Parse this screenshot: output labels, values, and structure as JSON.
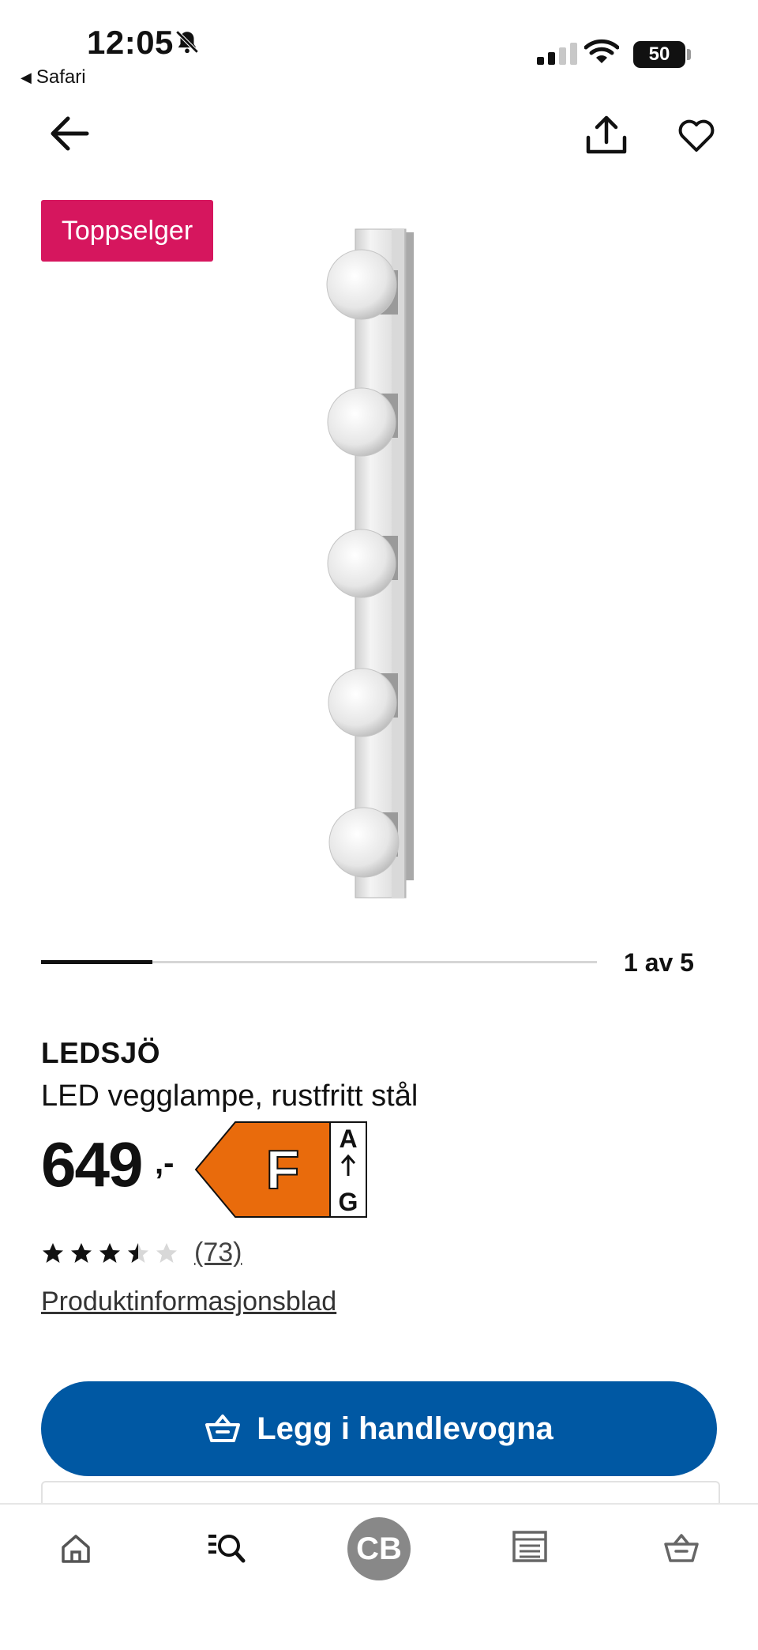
{
  "status": {
    "time": "12:05",
    "back_app": "Safari",
    "battery": "50"
  },
  "badge": "Toppselger",
  "carousel": {
    "pager": "1 av 5",
    "progress": 0.2
  },
  "product": {
    "brand": "LEDSJÖ",
    "description": "LED vegglampe, rustfritt stål",
    "price": "649",
    "price_suffix": ",-",
    "energy_class": "F",
    "energy_scale_top": "A",
    "energy_scale_bottom": "G",
    "rating": 3.5,
    "rating_max": 5,
    "reviews": "(73)",
    "info_link": "Produktinformasjonsblad"
  },
  "cta": {
    "label": "Legg i handlevogna"
  },
  "bottom_nav": {
    "avatar_initials": "CB"
  },
  "colors": {
    "badge": "#d6165e",
    "cta": "#0058a3",
    "energy_F": "#e96b0c"
  },
  "icons": [
    "bell-muted-icon",
    "signal-icon",
    "wifi-icon",
    "battery-icon",
    "back-arrow-icon",
    "share-icon",
    "heart-icon",
    "star-icon",
    "basket-icon",
    "home-icon",
    "search-icon",
    "store-icon",
    "cart-icon"
  ]
}
